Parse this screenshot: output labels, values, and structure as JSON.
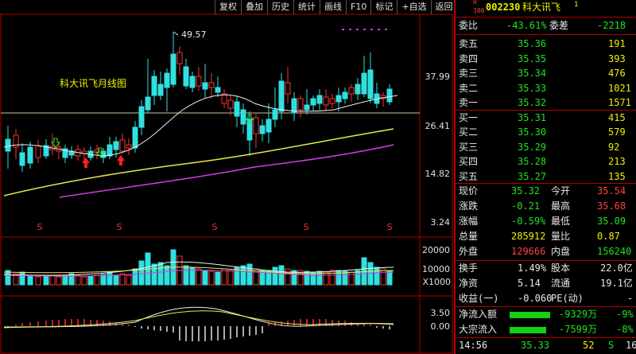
{
  "toolbar": {
    "buttons": [
      "复权",
      "叠加",
      "历史",
      "统计",
      "画线",
      "F10",
      "标记",
      "+自选",
      "返回"
    ]
  },
  "stock": {
    "code": "002230",
    "name": "科大讯飞",
    "sup": "1",
    "r_label": "R",
    "market": "300"
  },
  "chart": {
    "title": "科大讯飞月线图",
    "hi_label": "49.57",
    "price_axis": [
      "37.99",
      "26.41",
      "14.82",
      "3.24"
    ],
    "vol_axis": [
      "20000",
      "10000",
      "X1000"
    ],
    "macd_axis": [
      "3.50",
      "0.00"
    ],
    "s_marks": [
      "S",
      "S",
      "S",
      "S",
      "S"
    ],
    "colors": {
      "up": "#ff3030",
      "down": "#30e0e0",
      "ma1": "#f0f0f0",
      "ma2": "#e8e84a",
      "ma3": "#d040e0",
      "frame": "#b00000"
    }
  },
  "quote": {
    "weibi_label": "委比",
    "weibi": "-43.61%",
    "weicha_label": "委差",
    "weicha": "-2218",
    "sells": [
      {
        "label": "卖五",
        "price": "35.36",
        "vol": "191"
      },
      {
        "label": "卖四",
        "price": "35.35",
        "vol": "393"
      },
      {
        "label": "卖三",
        "price": "35.34",
        "vol": "476"
      },
      {
        "label": "卖二",
        "price": "35.33",
        "vol": "1021"
      },
      {
        "label": "卖一",
        "price": "35.32",
        "vol": "1571"
      }
    ],
    "buys": [
      {
        "label": "买一",
        "price": "35.31",
        "vol": "415"
      },
      {
        "label": "买二",
        "price": "35.30",
        "vol": "579"
      },
      {
        "label": "买三",
        "price": "35.29",
        "vol": "92"
      },
      {
        "label": "买四",
        "price": "35.28",
        "vol": "213"
      },
      {
        "label": "买五",
        "price": "35.27",
        "vol": "135"
      }
    ],
    "stats": [
      {
        "l1": "现价",
        "v1": "35.32",
        "l2": "今开",
        "v2": "35.54",
        "c1": "g",
        "c2": "r"
      },
      {
        "l1": "涨跌",
        "v1": "-0.21",
        "l2": "最高",
        "v2": "35.68",
        "c1": "g",
        "c2": "r"
      },
      {
        "l1": "涨幅",
        "v1": "-0.59%",
        "l2": "最低",
        "v2": "35.09",
        "c1": "g",
        "c2": "g"
      },
      {
        "l1": "总量",
        "v1": "285912",
        "l2": "量比",
        "v2": "0.87",
        "c1": "y",
        "c2": "y"
      },
      {
        "l1": "外盘",
        "v1": "129666",
        "l2": "内盘",
        "v2": "156240",
        "c1": "r",
        "c2": "g"
      }
    ],
    "stats2": [
      {
        "l1": "换手",
        "v1": "1.49%",
        "l2": "股本",
        "v2": "22.0亿"
      },
      {
        "l1": "净资",
        "v1": "5.14",
        "l2": "流通",
        "v2": "19.1亿"
      }
    ],
    "shouyi_label": "收益(一)",
    "shouyi": "-0.060",
    "pe_label": "PE(动)",
    "pe": "-",
    "flow": [
      {
        "label": "净流入额",
        "value": "-9329万",
        "pct": "-9%",
        "bar": 0.95
      },
      {
        "label": "大宗流入",
        "value": "-7599万",
        "pct": "-8%",
        "bar": 0.85
      }
    ],
    "tick": {
      "time": "14:56",
      "price": "35.33",
      "vol": "52",
      "dir": "S",
      "num": "16"
    }
  }
}
